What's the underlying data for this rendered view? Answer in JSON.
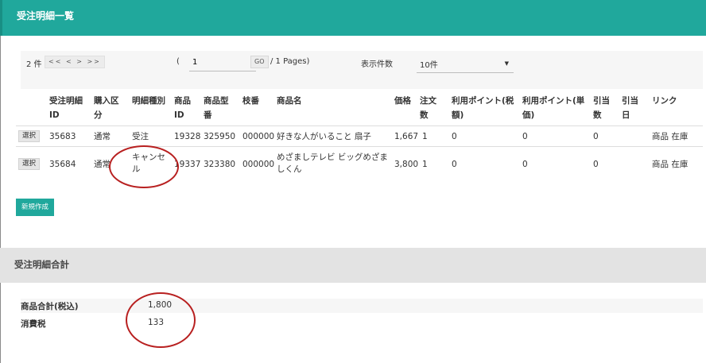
{
  "header": {
    "title": "受注明細一覧"
  },
  "pager": {
    "total": "2 件",
    "nav": "<< < > >>",
    "paren": "(",
    "page_value": "1",
    "go_label": "GO",
    "pages_text": "/ 1 Pages)",
    "perpage_label": "表示件数",
    "perpage_value": "10件"
  },
  "table": {
    "columns": [
      "受注明細ID",
      "購入区分",
      "明細種別",
      "商品ID",
      "商品型番",
      "枝番",
      "商品名",
      "価格",
      "注文数",
      "利用ポイント(税額)",
      "利用ポイント(単価)",
      "引当数",
      "引当日",
      "リンク"
    ],
    "rows": [
      {
        "select": "選択",
        "id": "35683",
        "kubun": "通常",
        "type": "受注",
        "product_id": "19328",
        "model": "325950",
        "branch": "000000",
        "name": "好きな人がいること 扇子",
        "price": "1,667",
        "qty": "1",
        "pt_tax": "0",
        "pt_unit": "0",
        "alloc": "0",
        "alloc_date": "",
        "link": "商品 在庫"
      },
      {
        "select": "選択",
        "id": "35684",
        "kubun": "通常",
        "type": "キャンセル",
        "product_id": "19337",
        "model": "323380",
        "branch": "000000",
        "name": "めざましテレビ ビッグめざましくん",
        "price": "3,800",
        "qty": "1",
        "pt_tax": "0",
        "pt_unit": "0",
        "alloc": "0",
        "alloc_date": "",
        "link": "商品 在庫"
      }
    ]
  },
  "new_button": "新規作成",
  "summary": {
    "title": "受注明細合計",
    "rows": [
      {
        "label": "商品合計(税込)",
        "value": "1,800"
      },
      {
        "label": "消費税",
        "value": "133"
      }
    ]
  },
  "colors": {
    "accent": "#20a89c",
    "annotation": "#b82020"
  }
}
